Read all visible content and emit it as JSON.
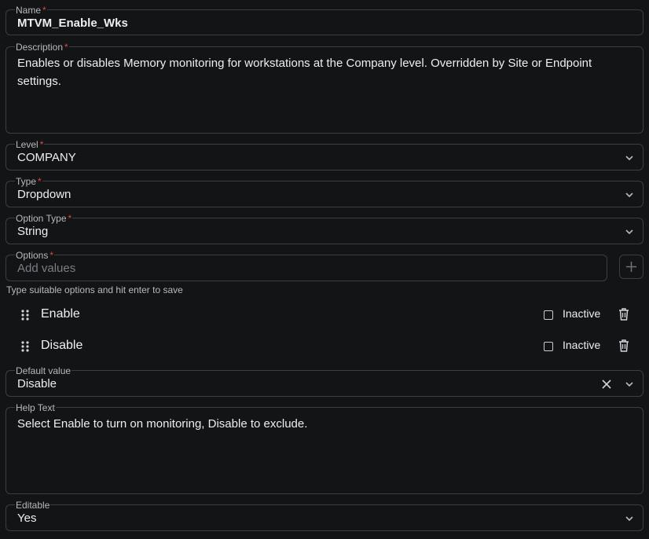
{
  "name": {
    "label": "Name",
    "required_mark": "*",
    "value": "MTVM_Enable_Wks"
  },
  "description": {
    "label": "Description",
    "required_mark": "*",
    "value": "Enables or disables Memory monitoring for workstations at the Company level. Overridden by Site or Endpoint settings."
  },
  "level": {
    "label": "Level",
    "required_mark": "*",
    "value": "COMPANY",
    "icon": "chevron-down-icon"
  },
  "type": {
    "label": "Type",
    "required_mark": "*",
    "value": "Dropdown",
    "icon": "chevron-down-icon"
  },
  "option_type": {
    "label": "Option Type",
    "required_mark": "*",
    "value": "String",
    "icon": "chevron-down-icon"
  },
  "options": {
    "label": "Options",
    "required_mark": "*",
    "placeholder": "Add values",
    "add_icon": "plus-icon",
    "hint": "Type suitable options and hit enter to save",
    "items": [
      {
        "label": "Enable",
        "inactive_label": "Inactive",
        "inactive_checked": false,
        "drag_icon": "drag-handle-icon",
        "delete_icon": "trash-icon"
      },
      {
        "label": "Disable",
        "inactive_label": "Inactive",
        "inactive_checked": false,
        "drag_icon": "drag-handle-icon",
        "delete_icon": "trash-icon"
      }
    ]
  },
  "default_value": {
    "label": "Default value",
    "value": "Disable",
    "clear_icon": "close-icon",
    "icon": "chevron-down-icon"
  },
  "help_text": {
    "label": "Help Text",
    "value": "Select Enable to turn on monitoring, Disable to exclude."
  },
  "editable": {
    "label": "Editable",
    "value": "Yes",
    "icon": "chevron-down-icon"
  },
  "colors": {
    "background": "#131416",
    "border": "#3b3e43",
    "required": "#e0474b",
    "text": "#eceef0",
    "muted": "#b7bac0"
  }
}
